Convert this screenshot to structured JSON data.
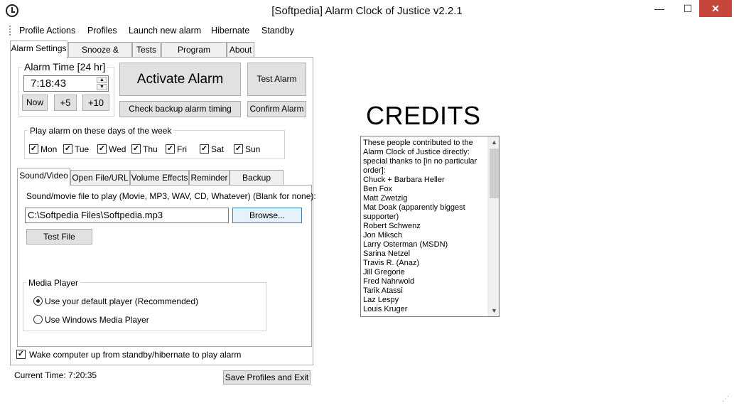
{
  "window": {
    "title": "[Softpedia] Alarm Clock of Justice v2.2.1",
    "min_label": "—",
    "max_label": "☐",
    "close_label": "✕"
  },
  "menu": [
    "Profile Actions",
    "Profiles",
    "Launch new alarm",
    "Hibernate",
    "Standby"
  ],
  "main_tabs": [
    "Alarm Settings",
    "Snooze & Timing",
    "Tests",
    "Program Settings",
    "About"
  ],
  "alarm_time": {
    "label": "Alarm Time [24 hr]",
    "value": "7:18:43",
    "now": "Now",
    "plus5": "+5",
    "plus10": "+10"
  },
  "buttons": {
    "activate": "Activate Alarm",
    "test_alarm": "Test Alarm",
    "check_backup": "Check backup alarm timing",
    "confirm": "Confirm Alarm",
    "browse": "Browse...",
    "test_file": "Test File",
    "save_exit": "Save Profiles and Exit"
  },
  "days": {
    "label": "Play alarm on these days of the week",
    "items": [
      {
        "name": "Mon",
        "checked": true
      },
      {
        "name": "Tue",
        "checked": true
      },
      {
        "name": "Wed",
        "checked": true
      },
      {
        "name": "Thu",
        "checked": true
      },
      {
        "name": "Fri",
        "checked": true
      },
      {
        "name": "Sat",
        "checked": true
      },
      {
        "name": "Sun",
        "checked": true
      }
    ]
  },
  "sub_tabs": [
    "Sound/Video",
    "Open File/URL",
    "Volume Effects",
    "Reminder",
    "Backup Alarm"
  ],
  "sound": {
    "prompt": "Sound/movie file to play (Movie, MP3, WAV, CD, Whatever) (Blank for none):",
    "file_path": "C:\\Softpedia Files\\Softpedia.mp3"
  },
  "media_player": {
    "label": "Media Player",
    "options": [
      {
        "label": "Use your default player (Recommended)",
        "selected": true
      },
      {
        "label": "Use Windows Media Player",
        "selected": false
      }
    ]
  },
  "wake": {
    "label": "Wake computer up from standby/hibernate to play alarm",
    "checked": true
  },
  "status": {
    "current_time": "Current Time: 7:20:35"
  },
  "credits": {
    "title": "CREDITS",
    "lines": [
      "These people contributed to the",
      "Alarm Clock of Justice directly:",
      "special thanks to [in no particular",
      "order]:",
      "Chuck + Barbara Heller",
      "Ben Fox",
      "Matt Zwetzig",
      "Mat Doak (apparently biggest",
      "supporter)",
      "Robert Schwenz",
      "Jon Miksch",
      "Larry Osterman (MSDN)",
      "Sarina Netzel",
      "Travis R. (Anaz)",
      "Jill Gregorie",
      "Fred Nahrwold",
      "Tarik Atassi",
      "Laz Lespy",
      "Louis Kruger"
    ]
  }
}
